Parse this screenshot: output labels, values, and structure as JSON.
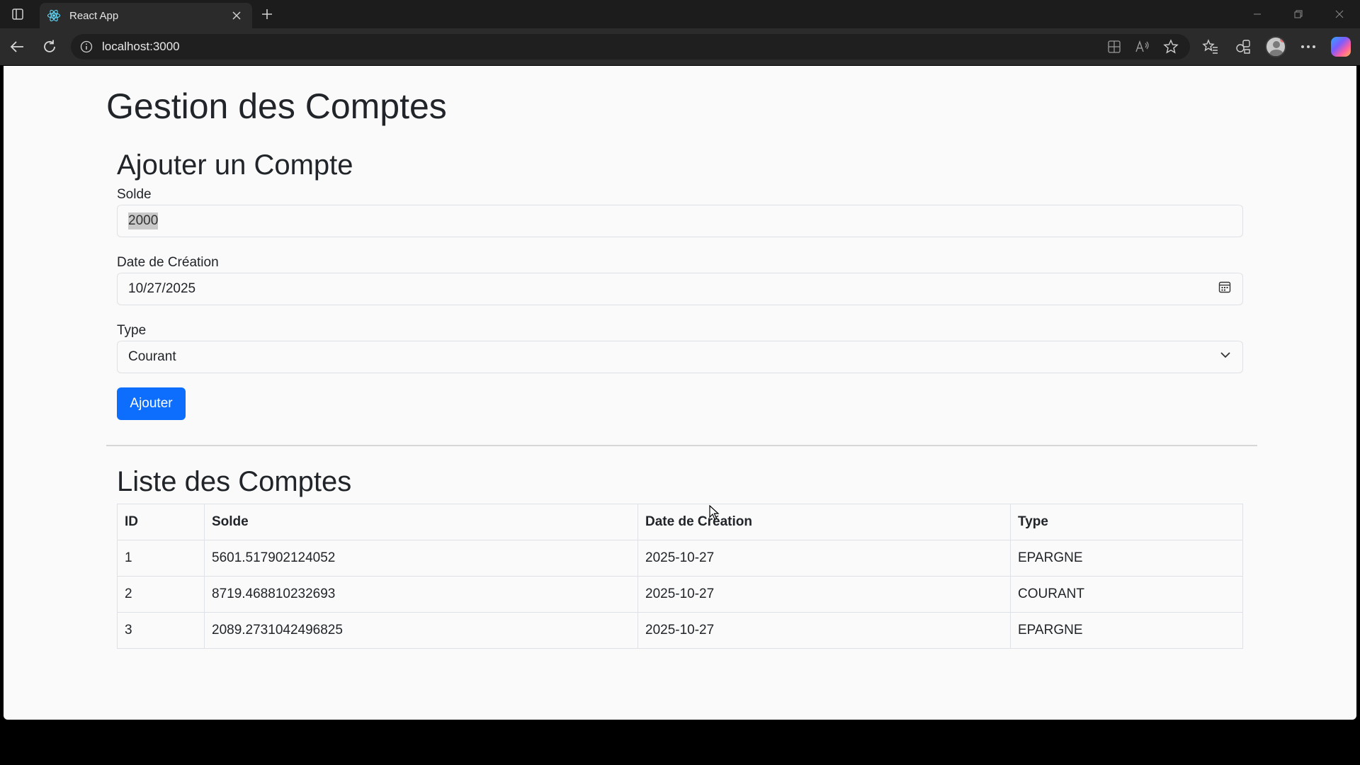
{
  "browser": {
    "tab_title": "React App",
    "url": "localhost:3000"
  },
  "page": {
    "title": "Gestion des Comptes"
  },
  "form": {
    "title": "Ajouter un Compte",
    "solde_label": "Solde",
    "solde_value": "2000",
    "date_label": "Date de Création",
    "date_value": "10/27/2025",
    "type_label": "Type",
    "type_value": "Courant",
    "submit_label": "Ajouter"
  },
  "list": {
    "title": "Liste des Comptes",
    "columns": [
      "ID",
      "Solde",
      "Date de Création",
      "Type"
    ],
    "rows": [
      [
        "1",
        "5601.517902124052",
        "2025-10-27",
        "EPARGNE"
      ],
      [
        "2",
        "8719.468810232693",
        "2025-10-27",
        "COURANT"
      ],
      [
        "3",
        "2089.2731042496825",
        "2025-10-27",
        "EPARGNE"
      ]
    ]
  },
  "colors": {
    "primary": "#0d6efd",
    "page_bg": "#fafafa",
    "chrome_bg": "#2b2b2b"
  }
}
